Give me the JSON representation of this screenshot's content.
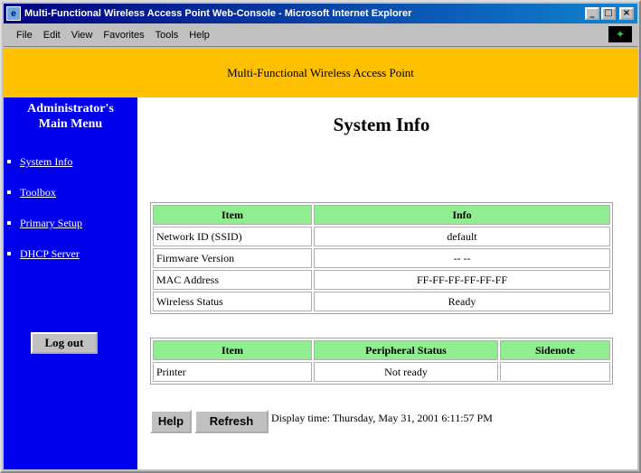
{
  "window": {
    "title": "Multi-Functional Wireless Access Point Web-Console - Microsoft Internet Explorer",
    "icon": "ie-page-icon",
    "controls": [
      "minimize",
      "maximize",
      "close"
    ]
  },
  "menubar": {
    "items": [
      "File",
      "Edit",
      "View",
      "Favorites",
      "Tools",
      "Help"
    ]
  },
  "banner": {
    "text": "Multi-Functional Wireless Access Point"
  },
  "sidebar": {
    "title_line1": "Administrator's",
    "title_line2": "Main Menu",
    "links": [
      "System Info",
      "Toolbox",
      "Primary Setup",
      "DHCP Server"
    ],
    "logout_label": "Log out"
  },
  "main": {
    "title": "System Info",
    "system_table": {
      "headers": [
        "Item",
        "Info"
      ],
      "rows": [
        [
          "Network ID (SSID)",
          "default"
        ],
        [
          "Firmware Version",
          "-- --"
        ],
        [
          "MAC Address",
          "FF-FF-FF-FF-FF-FF"
        ],
        [
          "Wireless Status",
          "Ready"
        ]
      ]
    },
    "peripheral_table": {
      "headers": [
        "Item",
        "Peripheral Status",
        "Sidenote"
      ],
      "rows": [
        [
          "Printer",
          "Not ready",
          ""
        ]
      ]
    },
    "help_label": "Help",
    "refresh_label": "Refresh",
    "display_time": "Display time: Thursday, May 31, 2001 6:11:57 PM"
  },
  "colors": {
    "banner": "#ffc000",
    "sidebar": "#0000ee",
    "table_header": "#90ee90",
    "titlebar": "#00007f"
  }
}
